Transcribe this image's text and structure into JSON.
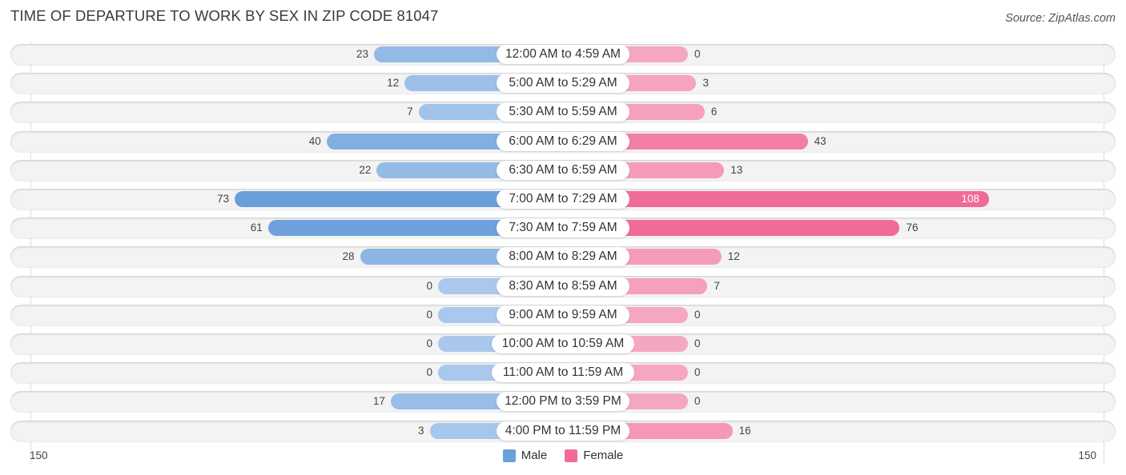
{
  "header": {
    "title": "TIME OF DEPARTURE TO WORK BY SEX IN ZIP CODE 81047",
    "source": "Source: ZipAtlas.com"
  },
  "colors": {
    "male_strong": "#6a9fdb",
    "male_light": "#a9c8ec",
    "female_strong": "#f06b97",
    "female_light": "#f6a7c0"
  },
  "legend": {
    "male": "Male",
    "female": "Female"
  },
  "axis": {
    "left_label": "150",
    "right_label": "150"
  },
  "chart_data": {
    "type": "bar",
    "orientation": "horizontal-diverging",
    "title": "TIME OF DEPARTURE TO WORK BY SEX IN ZIP CODE 81047",
    "categories": [
      "12:00 AM to 4:59 AM",
      "5:00 AM to 5:29 AM",
      "5:30 AM to 5:59 AM",
      "6:00 AM to 6:29 AM",
      "6:30 AM to 6:59 AM",
      "7:00 AM to 7:29 AM",
      "7:30 AM to 7:59 AM",
      "8:00 AM to 8:29 AM",
      "8:30 AM to 8:59 AM",
      "9:00 AM to 9:59 AM",
      "10:00 AM to 10:59 AM",
      "11:00 AM to 11:59 AM",
      "12:00 PM to 3:59 PM",
      "4:00 PM to 11:59 PM"
    ],
    "series": [
      {
        "name": "Male",
        "side": "left",
        "values": [
          23,
          12,
          7,
          40,
          22,
          73,
          61,
          28,
          0,
          0,
          0,
          0,
          17,
          3
        ]
      },
      {
        "name": "Female",
        "side": "right",
        "values": [
          0,
          3,
          6,
          43,
          13,
          108,
          76,
          12,
          7,
          0,
          0,
          0,
          0,
          16
        ]
      }
    ],
    "xlim": [
      -150,
      150
    ],
    "xlabel": "",
    "ylabel": "",
    "tick_labels": [
      "150",
      "150"
    ],
    "legend_position": "bottom-center",
    "grid": false
  }
}
